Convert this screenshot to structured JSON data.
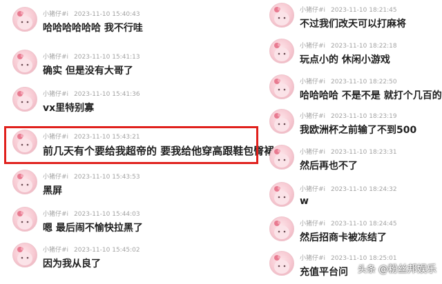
{
  "left_messages": [
    {
      "name": "小猪仔#i",
      "time": "2023-11-10 15:40:43",
      "text": "哈哈哈哈哈哈  我不行哇"
    },
    {
      "name": "小猪仔#i",
      "time": "2023-11-10 15:41:13",
      "text": "确实  但是没有大哥了"
    },
    {
      "name": "小猪仔#i",
      "time": "2023-11-10 15:41:36",
      "text": "vx里特别寡"
    },
    {
      "name": "小猪仔#i",
      "time": "2023-11-10 15:43:21",
      "text": "前几天有个要给我超帝的  要我给他穿高跟鞋包臀裙"
    },
    {
      "name": "小猪仔#i",
      "time": "2023-11-10 15:43:53",
      "text": "黑屏"
    },
    {
      "name": "小猪仔#i",
      "time": "2023-11-10 15:44:03",
      "text": "嗯  最后闹不愉快拉黑了"
    },
    {
      "name": "小猪仔#i",
      "time": "2023-11-10 15:45:02",
      "text": "因为我从良了"
    }
  ],
  "right_messages": [
    {
      "name": "小猪仔#i",
      "time": "2023-11-10 18:21:45",
      "text": "不过我们改天可以打麻将"
    },
    {
      "name": "小猪仔#i",
      "time": "2023-11-10 18:22:18",
      "text": "玩点小的  休闲小游戏"
    },
    {
      "name": "小猪仔#i",
      "time": "2023-11-10 18:22:50",
      "text": "哈哈哈哈  不是不是  就打个几百的"
    },
    {
      "name": "小猪仔#i",
      "time": "2023-11-10 18:23:19",
      "text": "我欧洲杯之前输了不到500"
    },
    {
      "name": "小猪仔#i",
      "time": "2023-11-10 18:23:31",
      "text": "然后再也不了"
    },
    {
      "name": "小猪仔#i",
      "time": "2023-11-10 18:24:32",
      "text": "w"
    },
    {
      "name": "小猪仔#i",
      "time": "2023-11-10 18:24:45",
      "text": "然后招商卡被冻结了"
    },
    {
      "name": "小猪仔#i",
      "time": "2023-11-10 18:25:01",
      "text": "充值平台问"
    }
  ],
  "watermark": {
    "logo": "头条",
    "text": "@粉丝邦娱乐"
  },
  "colors": {
    "highlight_border": "#e0201c",
    "meta_text": "#a3a3a3",
    "message_text": "#1f1f1f"
  }
}
